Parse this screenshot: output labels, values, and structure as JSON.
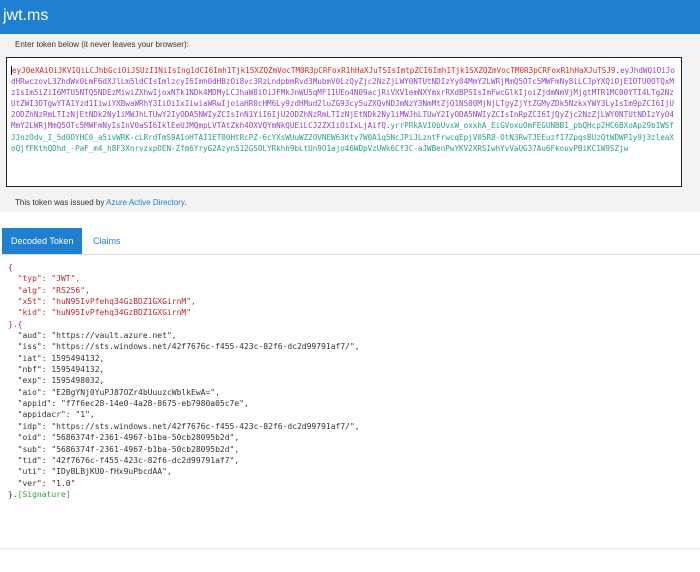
{
  "app": {
    "title": "jwt.ms"
  },
  "input": {
    "hint": "Enter token below (it never leaves your browser):"
  },
  "token": {
    "header_part": "eyJ0eXAiOiJKV1QiLCJhbGciOiJSUzI1NiIsIng1dCI6Imh1Tjk1SXZQZmVocTM0R3pCRFoxR1hHaXJuTSIsImtpZCI6Imh1Tjk1SXZQZmVocTM0R3pCRFoxR1hHaXJuTSJ9",
    "payload_part": "eyJhdWQiOiJodHRwczovL3ZhdWx0LmF6dXJlLm5ldCIsImlzcyI6Imh0dHBzOi8vc3RzLndpbmRvd3MubmV0LzQyZjc2NzZjLWY0NTUtNDIzYy04MmY2LWRjMmQ5OTc5MWFmNy8iLCJpYXQiOjE1OTU0OTQxMzIsIm5iZiI6MTU5NTQ5NDEzMiwiZXhwIjoxNTk1NDk4MDMyLCJhaW8iOiJFMkJnWU5qMF11UEo4N09acjRiVXV1emNXYmxrRXdBPSIsImFwcGlkIjoiZjdmNmVjMjgtMTR1MC00YTI4LTg2NzUtZWI3OTgwYTA1Yzd1IiwiYXBwaWRhY3IiOiIxIiwiaWRwIjoiaHR0cHM6Ly9zdHMud2luZG93cy5uZXQvNDJmNzY3NmMtZjQ1NS00MjNjLTgyZjYtZGMyZDk5NzkxYWY3LyIsIm9pZCI6IjU2ODZhNzRmLTIzNjEtNDk2Ny1iMWJhLTUwY2IyODA5NWIyZCIsInN1YiI6IjU2ODZhNzRmLTIzNjEtNDk2Ny1iMWJhLTUwY2IyODA5NWIyZCIsInRpZCI6IjQyZjc2NzZjLWY0NTUtNDIzYy04MmY2LWRjMmQ5OTc5MWFmNyIsInV0aSI6IklEeUJMQmpLVTAtZkh4OXVQYmNkQUEiLCJ2ZXIiOiIxLjAifQ",
    "signature_part": "yrrPRkAVI0bUvsW_oxxhA_EiGVoxuOmFEGUNBB1_pbQHcp2HC6BXoAp29b1WSfJJnzOdv_I_5d0OYHC0_a5ivWRK-cLRrdTmS9A1oHTAI1ET00HtRcPZ-6cYXsWUuWZ2OVNEW63Ktv7W0A1q5NcJPiJLzntFrwcqEpjV05R8-OtN3RwTJEEuzf17ZpqsBUzQtWDWP1y9j3zleaXoQjfFKthQDhd_-PaF_m4_h8F3XnrvzxpOEN-Zfm6YryG2Azyn512GSOLYRkhh9bLtUn9O1ajo46WDpVzUWk6Cf3C-aJWBenPwYKV2XRSIwhYvVaUG37Au6FkouvPBiKC1W9SZjw"
  },
  "issued": {
    "prefix": "This token was issued by ",
    "link": "Azure Active Directory",
    "suffix": "."
  },
  "tabs": [
    {
      "label": "Decoded Token"
    },
    {
      "label": "Claims"
    }
  ],
  "decoded": {
    "header_open": "{",
    "header_lines": [
      "  \"typ\": \"JWT\",",
      "  \"alg\": \"RS256\",",
      "  \"x5t\": \"huN95IvPfehq34GzBDZ1GXGirnM\",",
      "  \"kid\": \"huN95IvPfehq34GzBDZ1GXGirnM\""
    ],
    "separator": "}.{",
    "payload_lines": [
      "  \"aud\": \"https://vault.azure.net\",",
      "  \"iss\": \"https://sts.windows.net/42f7676c-f455-423c-82f6-dc2d99791af7/\",",
      "  \"iat\": 1595494132,",
      "  \"nbf\": 1595494132,",
      "  \"exp\": 1595498032,",
      "  \"aio\": \"E2BgYNj0YuPJ87OZr4bUuuzcWblkEwA=\",",
      "  \"appid\": \"f7f6ec28-14e0-4a28-8675-eb7980a05c7e\",",
      "  \"appidacr\": \"1\",",
      "  \"idp\": \"https://sts.windows.net/42f7676c-f455-423c-82f6-dc2d99791af7/\",",
      "  \"oid\": \"5686374f-2361-4967-b1ba-50cb28095b2d\",",
      "  \"sub\": \"5686374f-2361-4967-b1ba-50cb28095b2d\",",
      "  \"tid\": \"42f7676c-f455-423c-82f6-dc2d99791af7\",",
      "  \"uti\": \"IDyBLBjKU0-fHx9uPbcdAA\",",
      "  \"ver\": \"1.0\""
    ],
    "payload_close": "}.",
    "signature_label": "[Signature]"
  },
  "colors": {
    "accent": "#1f7fd0",
    "header": "#e0252a",
    "payload": "#9a3fc8",
    "signature": "#2aa08a"
  }
}
